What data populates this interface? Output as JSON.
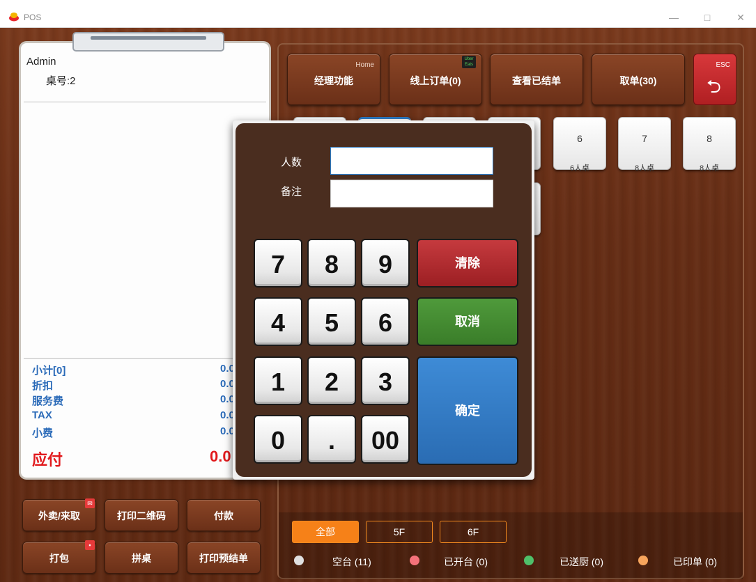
{
  "window": {
    "title": "POS",
    "min": "—",
    "max": "□",
    "close": "✕"
  },
  "order": {
    "user": "Admin",
    "table": "桌号:2",
    "summary": [
      {
        "label": "小计[0]",
        "value": "0.0"
      },
      {
        "label": "折扣",
        "value": "0.0"
      },
      {
        "label": "服务费",
        "value": "0.0"
      },
      {
        "label": "TAX",
        "value": "0.0"
      },
      {
        "label": "小费",
        "value": "0.0"
      }
    ],
    "due_label": "应付",
    "due_value": "0.0"
  },
  "left_buttons": {
    "takeout": "外卖/来取",
    "print_qr": "打印二维码",
    "pay": "付款",
    "pack": "打包",
    "merge": "拼桌",
    "print_prebill": "打印预结单"
  },
  "top_buttons": {
    "manager": {
      "label": "经理功能",
      "sub": "Home"
    },
    "online": {
      "label": "线上订单(0)",
      "badge": "Uber Eats"
    },
    "view_paid": {
      "label": "查看已结单"
    },
    "pickup": {
      "label": "取单(30)"
    },
    "esc": {
      "label": "ESC",
      "icon": "undo-arrow-icon"
    }
  },
  "tables": [
    {
      "num": "6",
      "cap": "6人桌"
    },
    {
      "num": "7",
      "cap": "8人桌"
    },
    {
      "num": "8",
      "cap": "8人桌"
    }
  ],
  "filters": [
    {
      "label": "全部",
      "active": true
    },
    {
      "label": "5F",
      "active": false
    },
    {
      "label": "6F",
      "active": false
    }
  ],
  "legend": [
    {
      "label": "空台 (11)",
      "color": "#e0e0e0"
    },
    {
      "label": "已开台 (0)",
      "color": "#f5727a"
    },
    {
      "label": "已送厨 (0)",
      "color": "#4fc06a"
    },
    {
      "label": "已印单 (0)",
      "color": "#f7a55d"
    }
  ],
  "dialog": {
    "people_label": "人数",
    "people_value": "",
    "note_label": "备注",
    "note_value": "",
    "keys": [
      "7",
      "8",
      "9",
      "4",
      "5",
      "6",
      "1",
      "2",
      "3",
      "0",
      ".",
      "00"
    ],
    "clear": "清除",
    "cancel": "取消",
    "ok": "确定"
  }
}
